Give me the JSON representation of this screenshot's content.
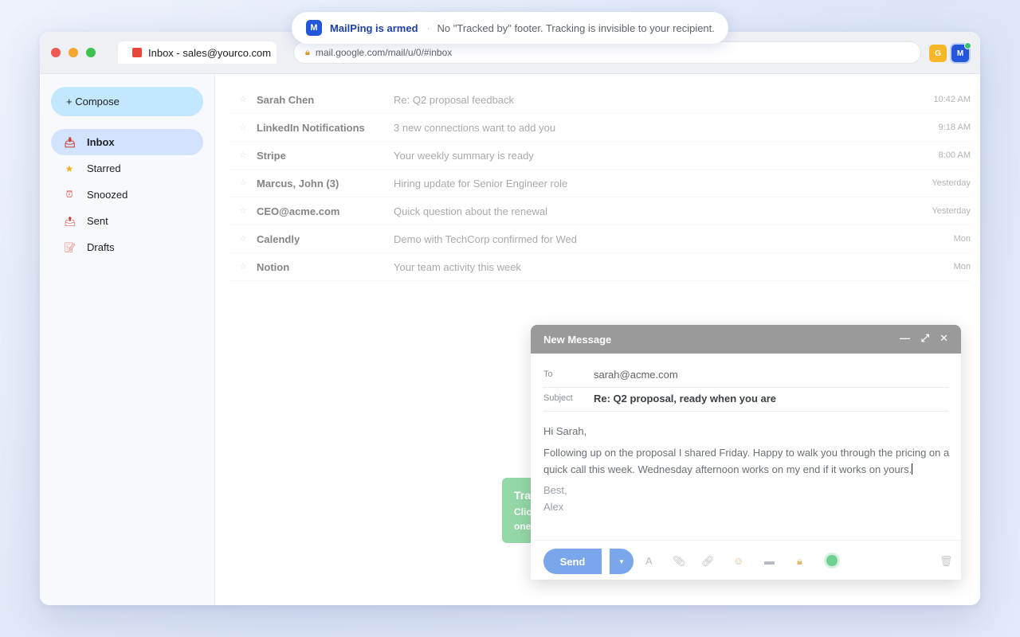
{
  "notification": {
    "logo_letter": "M",
    "title": "MailPing is armed",
    "separator": "·",
    "message": "No \"Tracked by\" footer. Tracking is invisible to your recipient."
  },
  "browser": {
    "tab_title": "Inbox - sales@yourco.com",
    "url": "mail.google.com/mail/u/0/#inbox",
    "extensions": [
      {
        "letter": "G",
        "color": "#f6b826"
      },
      {
        "letter": "M",
        "color": "#2356d9",
        "status_color": "#34c26e"
      }
    ]
  },
  "sidebar": {
    "compose_label": "+ Compose",
    "items": [
      {
        "label": "Inbox",
        "icon": "inbox-icon",
        "active": true
      },
      {
        "label": "Starred",
        "icon": "star-icon"
      },
      {
        "label": "Snoozed",
        "icon": "clock-icon"
      },
      {
        "label": "Sent",
        "icon": "sent-icon"
      },
      {
        "label": "Drafts",
        "icon": "draft-icon"
      }
    ]
  },
  "inbox": {
    "emails": [
      {
        "sender": "Sarah Chen",
        "subject": "Re: Q2 proposal feedback",
        "time": "10:42 AM"
      },
      {
        "sender": "LinkedIn Notifications",
        "subject": "3 new connections want to add you",
        "time": "9:18 AM"
      },
      {
        "sender": "Stripe",
        "subject": "Your weekly summary is ready",
        "time": "8:00 AM"
      },
      {
        "sender": "Marcus, John (3)",
        "subject": "Hiring update for Senior Engineer role",
        "time": "Yesterday"
      },
      {
        "sender": "CEO@acme.com",
        "subject": "Quick question about the renewal",
        "time": "Yesterday"
      },
      {
        "sender": "Calendly",
        "subject": "Demo with TechCorp confirmed for Wed",
        "time": "Mon"
      },
      {
        "sender": "Notion",
        "subject": "Your team activity this week",
        "time": "Mon"
      }
    ]
  },
  "tooltip": {
    "title": "Tra",
    "line1": "Clic",
    "line2": "one"
  },
  "composer": {
    "title": "New Message",
    "to_label": "To",
    "to_value": "sarah@acme.com",
    "subject_label": "Subject",
    "subject_value": "Re: Q2 proposal, ready when you are",
    "greeting": "Hi Sarah,",
    "body": "Following up on the proposal I shared Friday. Happy to walk you through the pricing on a quick call this week. Wednesday afternoon works on my end if it works on yours.",
    "signoff": "Best,",
    "signature": "Alex",
    "send_label": "Send",
    "tracking_indicator_color": "#6fd08f"
  },
  "colors": {
    "accent": "#2356d9",
    "compose_bg": "#c2e7ff",
    "active_nav_bg": "#d3e3fd",
    "send_bg": "#7aa7ec",
    "composer_header_bg": "#9a9a9a",
    "tooltip_bg": "#8fd6a4"
  }
}
